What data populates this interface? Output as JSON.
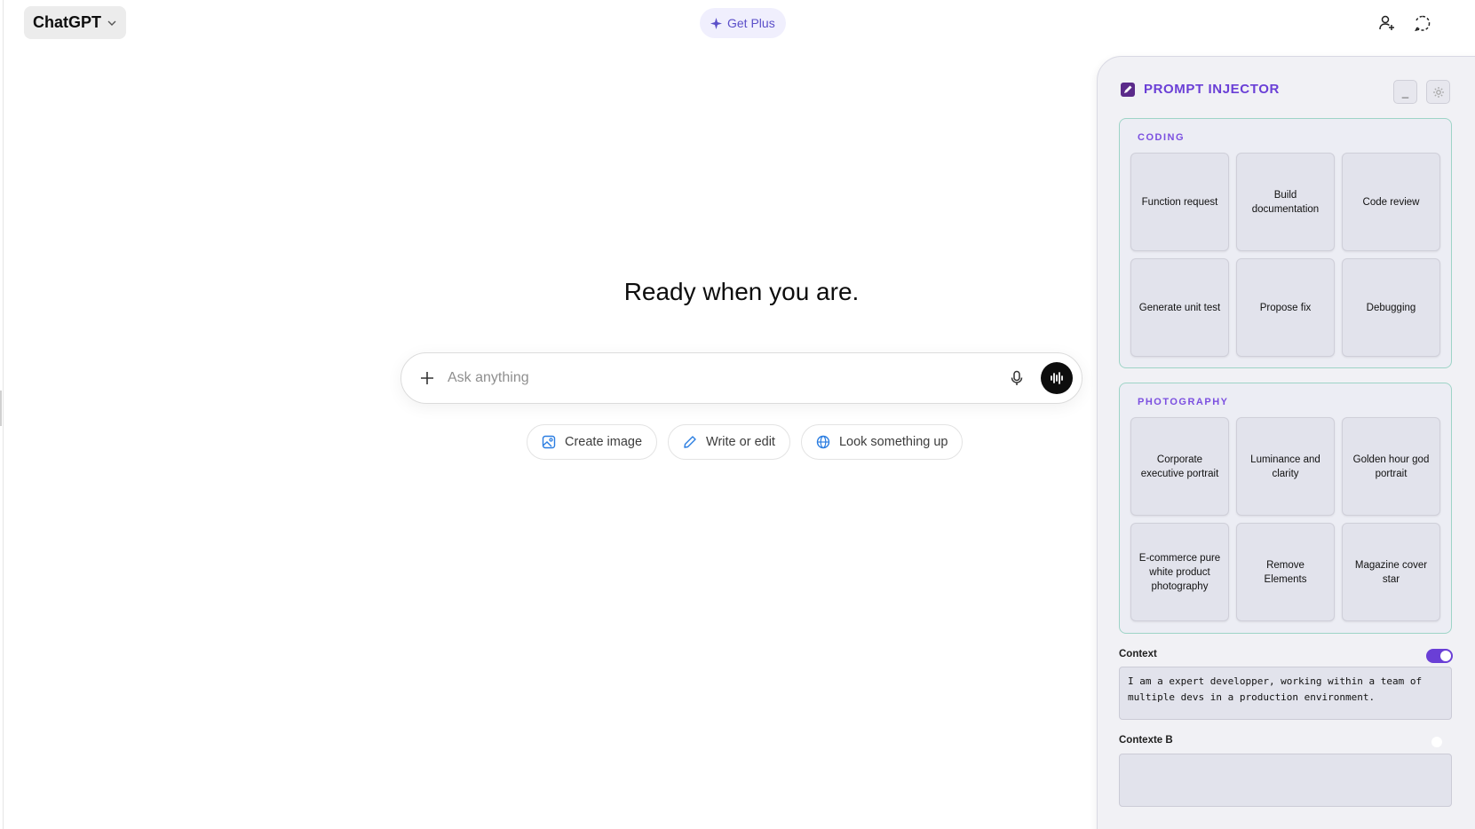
{
  "header": {
    "model_name": "ChatGPT",
    "get_plus_label": "Get Plus"
  },
  "main": {
    "headline": "Ready when you are.",
    "composer_placeholder": "Ask anything",
    "chips": [
      {
        "label": "Create image",
        "icon": "image-icon"
      },
      {
        "label": "Write or edit",
        "icon": "pencil-icon"
      },
      {
        "label": "Look something up",
        "icon": "globe-icon"
      }
    ]
  },
  "panel": {
    "title": "PROMPT INJECTOR",
    "minimize_label": "_",
    "sections": [
      {
        "label": "CODING",
        "items": [
          "Function request",
          "Build documentation",
          "Code review",
          "Generate unit test",
          "Propose fix",
          "Debugging"
        ]
      },
      {
        "label": "PHOTOGRAPHY",
        "items": [
          "Corporate executive portrait",
          "Luminance and clarity",
          "Golden hour god portrait",
          "E-commerce pure white product photography",
          "Remove Elements",
          "Magazine cover star"
        ]
      }
    ],
    "context": {
      "label": "Context",
      "enabled": true,
      "value": "I am a expert developper, working within a team of multiple devs in a production environment."
    },
    "context_b": {
      "label": "Contexte B",
      "enabled": false,
      "value": ""
    }
  },
  "colors": {
    "accent": "#6a3fd6",
    "section_border": "#9ed4c7",
    "plus_text": "#5b4fc9"
  }
}
